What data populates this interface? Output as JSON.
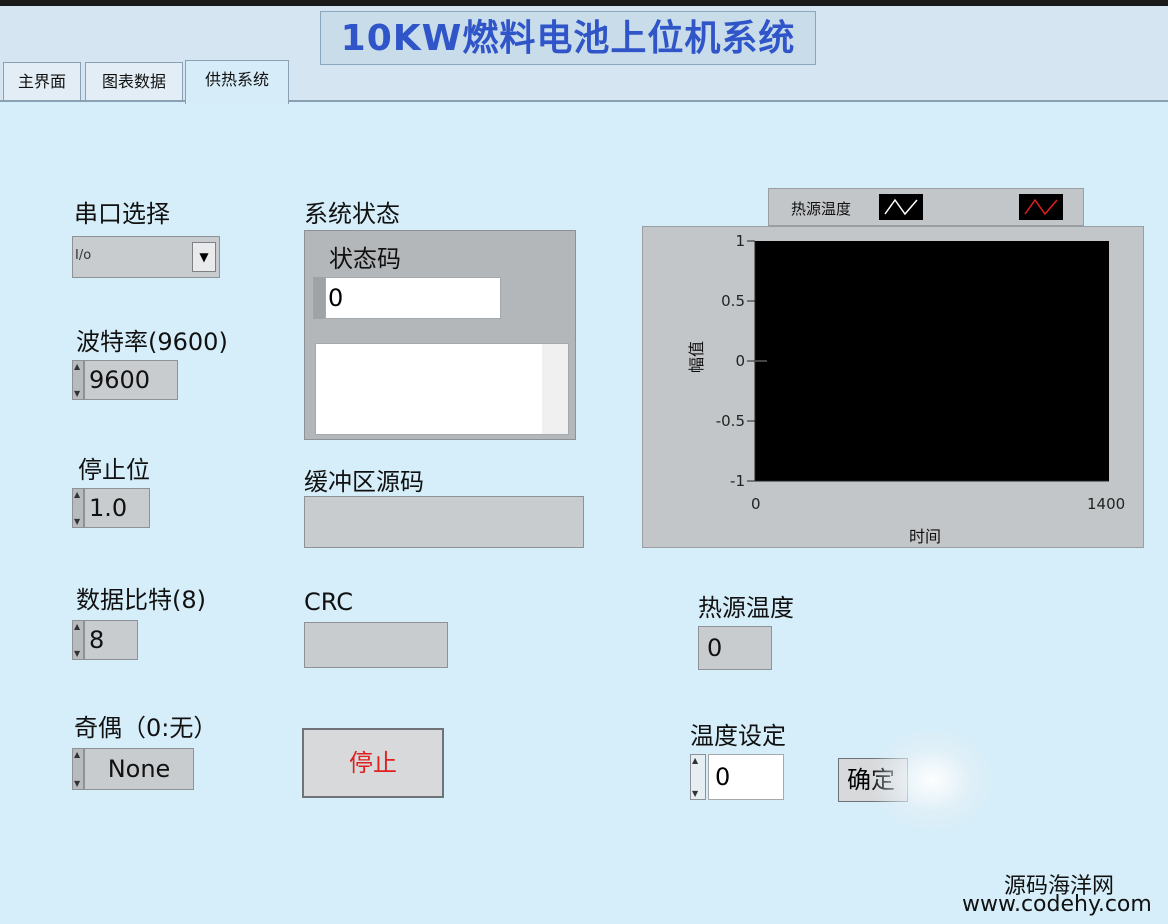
{
  "app": {
    "title": "10KW燃料电池上位机系统"
  },
  "tabs": [
    {
      "label": "主界面"
    },
    {
      "label": "图表数据"
    },
    {
      "label": "供热系统"
    }
  ],
  "serial": {
    "port_label": "串口选择",
    "port_prefix": "I/o",
    "baud_label": "波特率(9600)",
    "baud_value": "9600",
    "stop_bits_label": "停止位",
    "stop_bits_value": "1.0",
    "data_bits_label": "数据比特(8)",
    "data_bits_value": "8",
    "parity_label": "奇偶（0:无）",
    "parity_value": "None"
  },
  "status": {
    "label": "系统状态",
    "code_label": "状态码",
    "code_value": "0",
    "buffer_label": "缓冲区源码",
    "crc_label": "CRC",
    "stop_label": "停止"
  },
  "graph": {
    "legend": [
      {
        "name": "热源温度"
      }
    ],
    "ylabel": "幅值",
    "xlabel": "时间",
    "y_ticks": [
      "1",
      "0.5",
      "0",
      "-0.5",
      "-1"
    ],
    "x_ticks": [
      "0",
      "1400"
    ]
  },
  "heat": {
    "temp_label": "热源温度",
    "temp_value": "0",
    "setpoint_label": "温度设定",
    "setpoint_value": "0",
    "confirm_label": "确定"
  },
  "watermark": {
    "line1": "源码海洋网",
    "line2": "www.codehy.com"
  },
  "chart_data": {
    "type": "line",
    "x": [],
    "series": [
      {
        "name": "热源温度",
        "values": []
      }
    ],
    "xlabel": "时间",
    "ylabel": "幅值",
    "xlim": [
      0,
      1400
    ],
    "ylim": [
      -1,
      1
    ]
  }
}
